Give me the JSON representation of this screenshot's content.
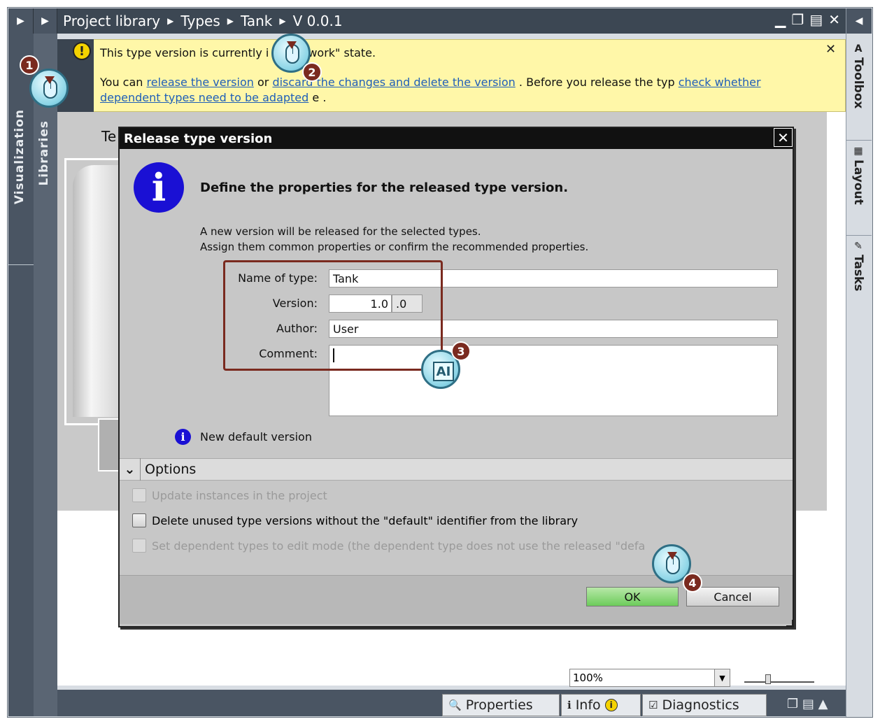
{
  "breadcrumb": [
    "Project library",
    "Types",
    "Tank",
    "V 0.0.1"
  ],
  "left_tabs": {
    "visualization": "Visualization",
    "libraries": "Libraries"
  },
  "right_tabs": [
    "Toolbox",
    "Layout",
    "Tasks"
  ],
  "warning": {
    "line1": "This type version is currently i",
    "line1_end": "work\" state.",
    "you_can": "You can",
    "link_release": "release the version",
    "or": "or",
    "link_discard": "discard the changes and delete the version",
    "before": ". Before you release the typ",
    "link_check": "check whether",
    "link_check2": "dependent types need to be adapted",
    "tail": "e ."
  },
  "editor": {
    "tank_label": "Te"
  },
  "dialog": {
    "title": "Release type version",
    "heading": "Define the properties for the released type version.",
    "desc1": "A new version will be released for the selected types.",
    "desc2": "Assign them common properties or confirm the recommended properties.",
    "fields": {
      "name_label": "Name of type:",
      "name_value": "Tank",
      "version_label": "Version:",
      "version_major": "1.0",
      "version_minor": ".0",
      "author_label": "Author:",
      "author_value": "User",
      "comment_label": "Comment:",
      "comment_value": ""
    },
    "info_note": "New default version",
    "options_label": "Options",
    "options": [
      {
        "label": "Update instances in the project",
        "enabled": false,
        "checked": false
      },
      {
        "label": "Delete unused type versions without the \"default\" identifier from the library",
        "enabled": true,
        "checked": false
      },
      {
        "label": "Set dependent types to edit mode (the dependent type does not use the released \"defa",
        "enabled": false,
        "checked": false
      }
    ],
    "ok_label": "OK",
    "cancel_label": "Cancel"
  },
  "status": {
    "zoom": "100%"
  },
  "bottom_tabs": [
    "Properties",
    "Info",
    "Diagnostics"
  ],
  "steps": [
    "1",
    "2",
    "3",
    "4"
  ]
}
